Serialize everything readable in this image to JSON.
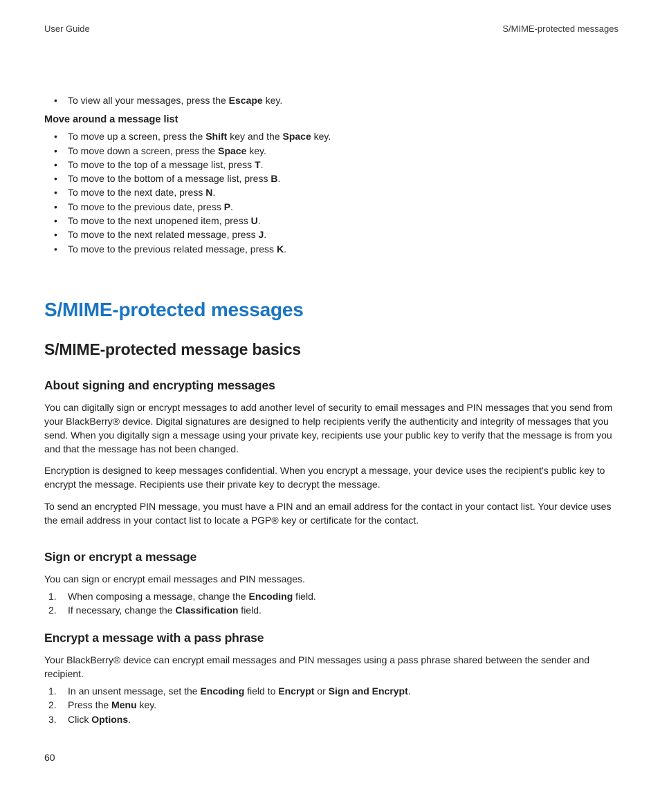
{
  "header": {
    "left": "User Guide",
    "right": "S/MIME-protected messages"
  },
  "top_bullet": {
    "pre": "To view all your messages, press the ",
    "bold": "Escape",
    "post": " key."
  },
  "move_heading": "Move around a message list",
  "move_items": [
    {
      "pre": "To move up a screen, press the ",
      "bold": "Shift",
      "mid": " key and the ",
      "bold2": "Space",
      "post": " key."
    },
    {
      "pre": "To move down a screen, press the ",
      "bold": "Space",
      "post": " key."
    },
    {
      "pre": "To move to the top of a message list, press ",
      "bold": "T",
      "post": "."
    },
    {
      "pre": "To move to the bottom of a message list, press ",
      "bold": "B",
      "post": "."
    },
    {
      "pre": "To move to the next date, press ",
      "bold": "N",
      "post": "."
    },
    {
      "pre": "To move to the previous date, press ",
      "bold": "P",
      "post": "."
    },
    {
      "pre": "To move to the next unopened item, press ",
      "bold": "U",
      "post": "."
    },
    {
      "pre": "To move to the next related message, press ",
      "bold": "J",
      "post": "."
    },
    {
      "pre": "To move to the previous related message, press ",
      "bold": "K",
      "post": "."
    }
  ],
  "h_blue": "S/MIME-protected messages",
  "h_black": "S/MIME-protected message basics",
  "sec1": {
    "title": "About signing and encrypting messages",
    "p1": "You can digitally sign or encrypt messages to add another level of security to email messages and PIN messages that you send from your BlackBerry® device. Digital signatures are designed to help recipients verify the authenticity and integrity of messages that you send. When you digitally sign a message using your private key, recipients use your public key to verify that the message is from you and that the message has not been changed.",
    "p2": "Encryption is designed to keep messages confidential. When you encrypt a message, your device uses the recipient's public key to encrypt the message. Recipients use their private key to decrypt the message.",
    "p3": "To send an encrypted PIN message, you must have a PIN and an email address for the contact in your contact list. Your device uses the email address in your contact list to locate a PGP® key or certificate for the contact."
  },
  "sec2": {
    "title": "Sign or encrypt a message",
    "intro": "You can sign or encrypt email messages and PIN messages.",
    "steps": [
      {
        "pre": "When composing a message, change the ",
        "bold": "Encoding",
        "post": " field."
      },
      {
        "pre": "If necessary, change the ",
        "bold": "Classification",
        "post": " field."
      }
    ]
  },
  "sec3": {
    "title": "Encrypt a message with a pass phrase",
    "intro": "Your BlackBerry® device can encrypt email messages and PIN messages using a pass phrase shared between the sender and recipient.",
    "steps": [
      {
        "pre": "In an unsent message, set the ",
        "bold": "Encoding",
        "mid": " field to ",
        "bold2": "Encrypt",
        "mid2": " or ",
        "bold3": "Sign and Encrypt",
        "post": "."
      },
      {
        "pre": "Press the ",
        "bold": "Menu",
        "post": " key."
      },
      {
        "pre": "Click ",
        "bold": "Options",
        "post": "."
      }
    ]
  },
  "page_number": "60"
}
